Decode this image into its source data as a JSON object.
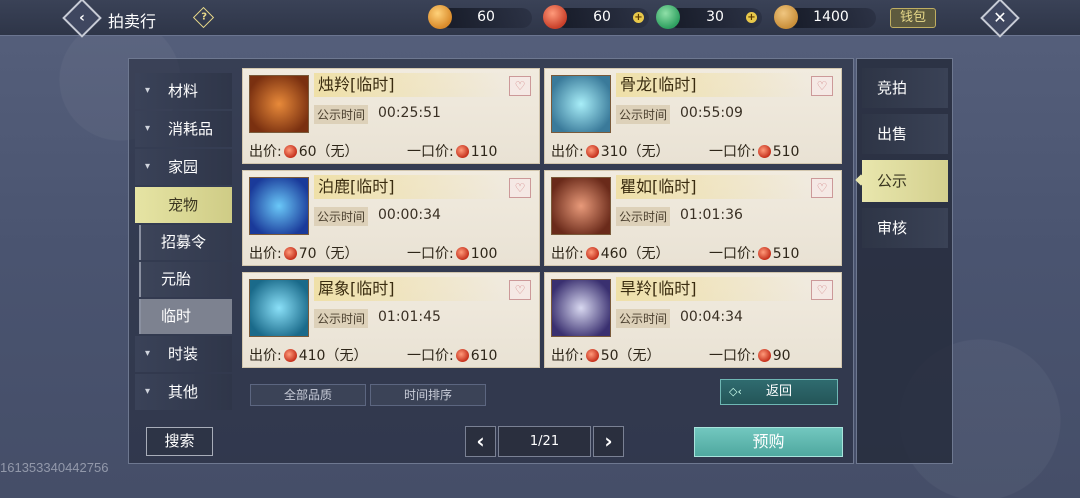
{
  "header": {
    "title": "拍卖行",
    "help_label": "?",
    "wallet_label": "钱包",
    "back_label": "‹",
    "close_label": "✕"
  },
  "currencies": [
    {
      "name": "gold-ingot",
      "value": "60",
      "color": "#d98a2a"
    },
    {
      "name": "red-coin",
      "value": "60",
      "color": "#c9402a"
    },
    {
      "name": "jade-coin",
      "value": "30",
      "color": "#2fa060"
    },
    {
      "name": "copper-coin",
      "value": "1400",
      "color": "#c98f3a"
    }
  ],
  "categories": [
    {
      "label": "材料",
      "arrow": "▾"
    },
    {
      "label": "消耗品",
      "arrow": "▾"
    },
    {
      "label": "家园",
      "arrow": "▾"
    },
    {
      "label": "宠物",
      "arrow": ""
    }
  ],
  "subcategories": [
    {
      "label": "招募令"
    },
    {
      "label": "元胎"
    },
    {
      "label": "临时"
    }
  ],
  "categories_bottom": [
    {
      "label": "时装",
      "arrow": "▾"
    },
    {
      "label": "其他",
      "arrow": "▾"
    }
  ],
  "cards": [
    {
      "name": "烛羚[临时]",
      "pub_label": "公示时间",
      "pub_time": "00:25:51",
      "bid_label": "出价:",
      "bid": "60（无）",
      "buy_label": "一口价:",
      "buy": "110",
      "thumb_color": "#b8542a"
    },
    {
      "name": "骨龙[临时]",
      "pub_label": "公示时间",
      "pub_time": "00:55:09",
      "bid_label": "出价:",
      "bid": "310（无）",
      "buy_label": "一口价:",
      "buy": "510",
      "thumb_color": "#5fb6c8"
    },
    {
      "name": "泊鹿[临时]",
      "pub_label": "公示时间",
      "pub_time": "00:00:34",
      "bid_label": "出价:",
      "bid": "70（无）",
      "buy_label": "一口价:",
      "buy": "100",
      "thumb_color": "#2a78c9"
    },
    {
      "name": "瞿如[临时]",
      "pub_label": "公示时间",
      "pub_time": "01:01:36",
      "bid_label": "出价:",
      "bid": "460（无）",
      "buy_label": "一口价:",
      "buy": "510",
      "thumb_color": "#9a3a2a"
    },
    {
      "name": "犀象[临时]",
      "pub_label": "公示时间",
      "pub_time": "01:01:45",
      "bid_label": "出价:",
      "bid": "410（无）",
      "buy_label": "一口价:",
      "buy": "610",
      "thumb_color": "#3aa6c9"
    },
    {
      "name": "旱羚[临时]",
      "pub_label": "公示时间",
      "pub_time": "00:04:34",
      "bid_label": "出价:",
      "bid": "50（无）",
      "buy_label": "一口价:",
      "buy": "90",
      "thumb_color": "#7a78a8"
    }
  ],
  "filters": {
    "quality": "全部品质",
    "sort": "时间排序",
    "return_label": "返回"
  },
  "footer": {
    "search_label": "搜索",
    "prev": "‹",
    "next": "›",
    "page": "1/21",
    "preorder_label": "预购"
  },
  "side_tabs": [
    {
      "label": "竞拍"
    },
    {
      "label": "出售"
    },
    {
      "label": "公示"
    },
    {
      "label": "审核"
    }
  ],
  "watermark": "161353340442756"
}
